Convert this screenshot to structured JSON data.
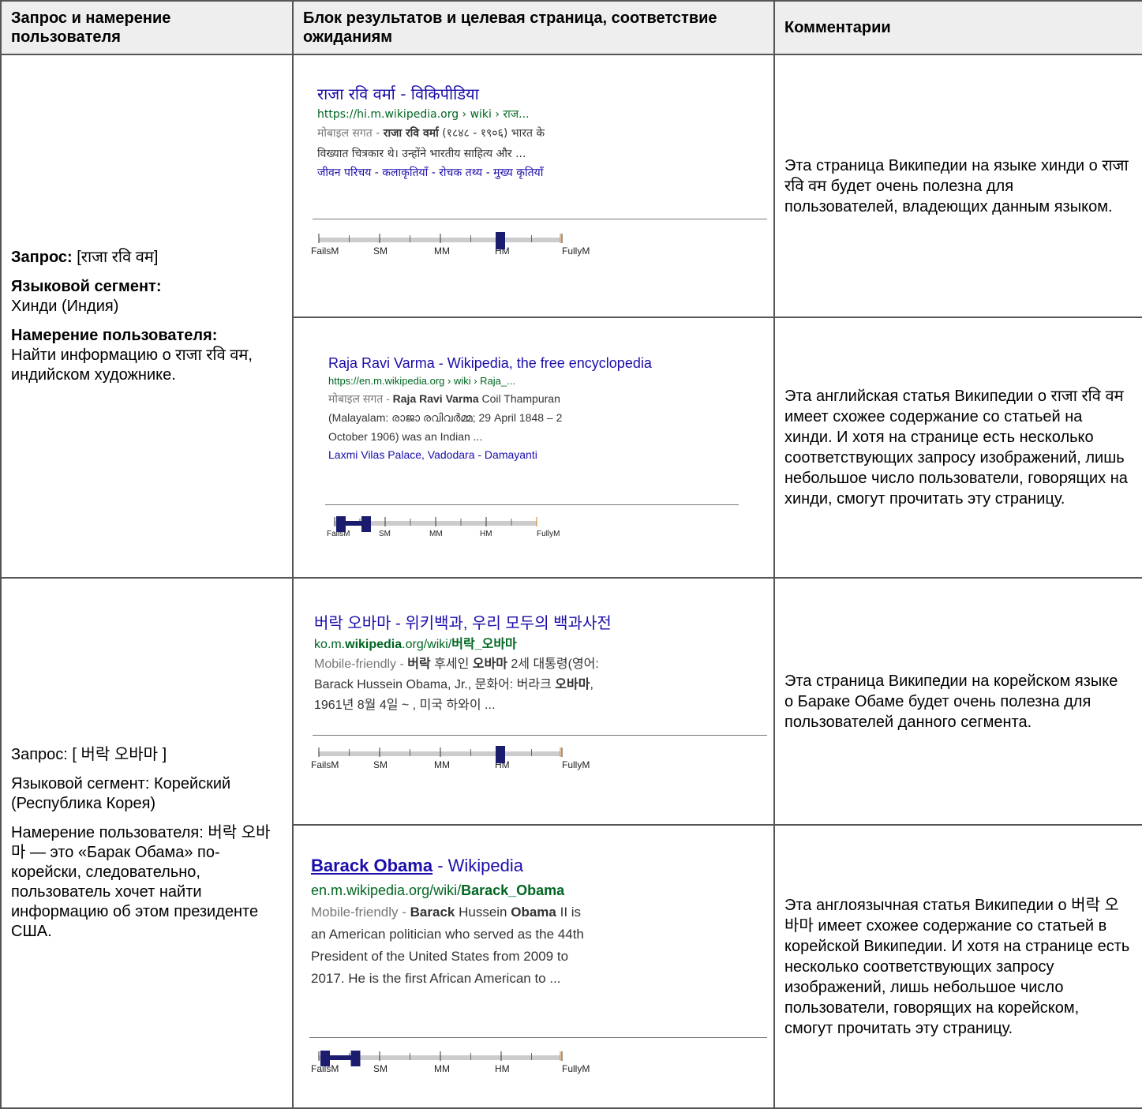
{
  "headers": {
    "col1": "Запрос и намерение пользователя",
    "col2": "Блок результатов и целевая страница, соответствие ожиданиям",
    "col3": "Комментарии"
  },
  "scale_labels": [
    "FailsM",
    "SM",
    "MM",
    "HM",
    "FullyM"
  ],
  "rows": [
    {
      "query": {
        "query_label": "Запрос:",
        "query_value": " [राजा रवि वम]",
        "segment_label": "Языковой сегмент:",
        "segment_value": "Хинди (Индия)",
        "intent_label": "Намерение пользователя:",
        "intent_value": "Найти информацию о राजा रवि वम, индийском художнике."
      },
      "results": [
        {
          "title": "राजा रवि वर्मा - विकिपीडिया",
          "url": "https://hi.m.wikipedia.org › wiki › राज...",
          "line1_gray": "मोबाइल सगत - ",
          "line1_bold": "राजा रवि वर्मा",
          "line1_rest": " (१८४८ - १९०६) भारत के",
          "line2": "विख्यात चित्रकार थे। उन्होंने भारतीय साहित्य और ...",
          "links": "जीवन परिचय - कलाकृतियाँ - रोचक तथ्य - मुख्य कृतियाँ",
          "rating": "HM",
          "comment": "Эта страница Википедии на языке хинди о राजा रवि वम будет очень полезна для пользователей, владеющих данным языком."
        },
        {
          "title": "Raja Ravi Varma - Wikipedia, the free encyclopedia",
          "url": "https://en.m.wikipedia.org › wiki › Raja_...",
          "line1_gray": "मोबाइल सगत - ",
          "line1_bold": "Raja Ravi Varma",
          "line1_rest": " Coil Thampuran",
          "line2": "(Malayalam: രാജാ രവിവർമ്മ; 29 April 1848 – 2",
          "line3": "October 1906) was an Indian ...",
          "links": "Laxmi Vilas Palace, Vadodara - Damayanti",
          "rating": "FailsM-SM",
          "comment": "Эта английская статья Википедии о राजा रवि वम имеет схожее содержание со статьей на хинди. И хотя на странице есть несколько соответствующих запросу изображений, лишь небольшое число пользователи, говорящих на хинди, смогут прочитать эту страницу."
        }
      ]
    },
    {
      "query": {
        "query_label": "Запрос:",
        "query_value": " [ 버락 오바마 ]",
        "segment_label": "Языковой сегмент:",
        "segment_value": " Корейский (Республика Корея)",
        "intent_label": "Намерение пользователя:",
        "intent_value": " 버락 오바마 — это «Барак Обама» по-корейски, следовательно, пользователь хочет найти информацию об этом президенте США."
      },
      "results": [
        {
          "title": "버락 오바마 - 위키백과, 우리 모두의 백과사전",
          "url_pre": "ko.m.",
          "url_bold": "wikipedia",
          "url_post": ".org/wiki/",
          "url_bold2": "버락_오바마",
          "line1_gray": "Mobile-friendly - ",
          "line1_bold": "버락",
          "line1_mid": " 후세인 ",
          "line1_bold2": "오바마",
          "line1_rest": " 2세 대통령(영어:",
          "line2_a": "Barack Hussein Obama, Jr., 문화어: 버라크 ",
          "line2_b": "오바마",
          "line2_c": ",",
          "line3": "1961년 8월 4일 ~ , 미국 하와이 ...",
          "rating": "HM",
          "comment": "Эта страница Википедии на корейском языке о Бараке Обаме будет очень полезна для пользователей данного сегмента."
        },
        {
          "title_bold": "Barack Obama",
          "title_rest": " - Wikipedia",
          "url_pre": "en.m.wikipedia.org/wiki/",
          "url_bold": "Barack_Obama",
          "line1_gray": "Mobile-friendly - ",
          "line1_bold": "Barack",
          "line1_mid": " Hussein ",
          "line1_bold2": "Obama",
          "line1_rest": " II is",
          "line2": "an American politician who served as the 44th",
          "line3": "President of the United States from 2009 to",
          "line4": "2017. He is the first African American to ...",
          "rating": "FailsM-SM",
          "comment": "Эта англоязычная статья Википедии о 버락 오바마 имеет схожее содержание со статьей в корейской Википедии. И хотя на странице есть несколько соответствующих запросу изображений, лишь небольшое число пользователи, говорящих на корейском, смогут прочитать эту страницу."
        }
      ]
    }
  ]
}
